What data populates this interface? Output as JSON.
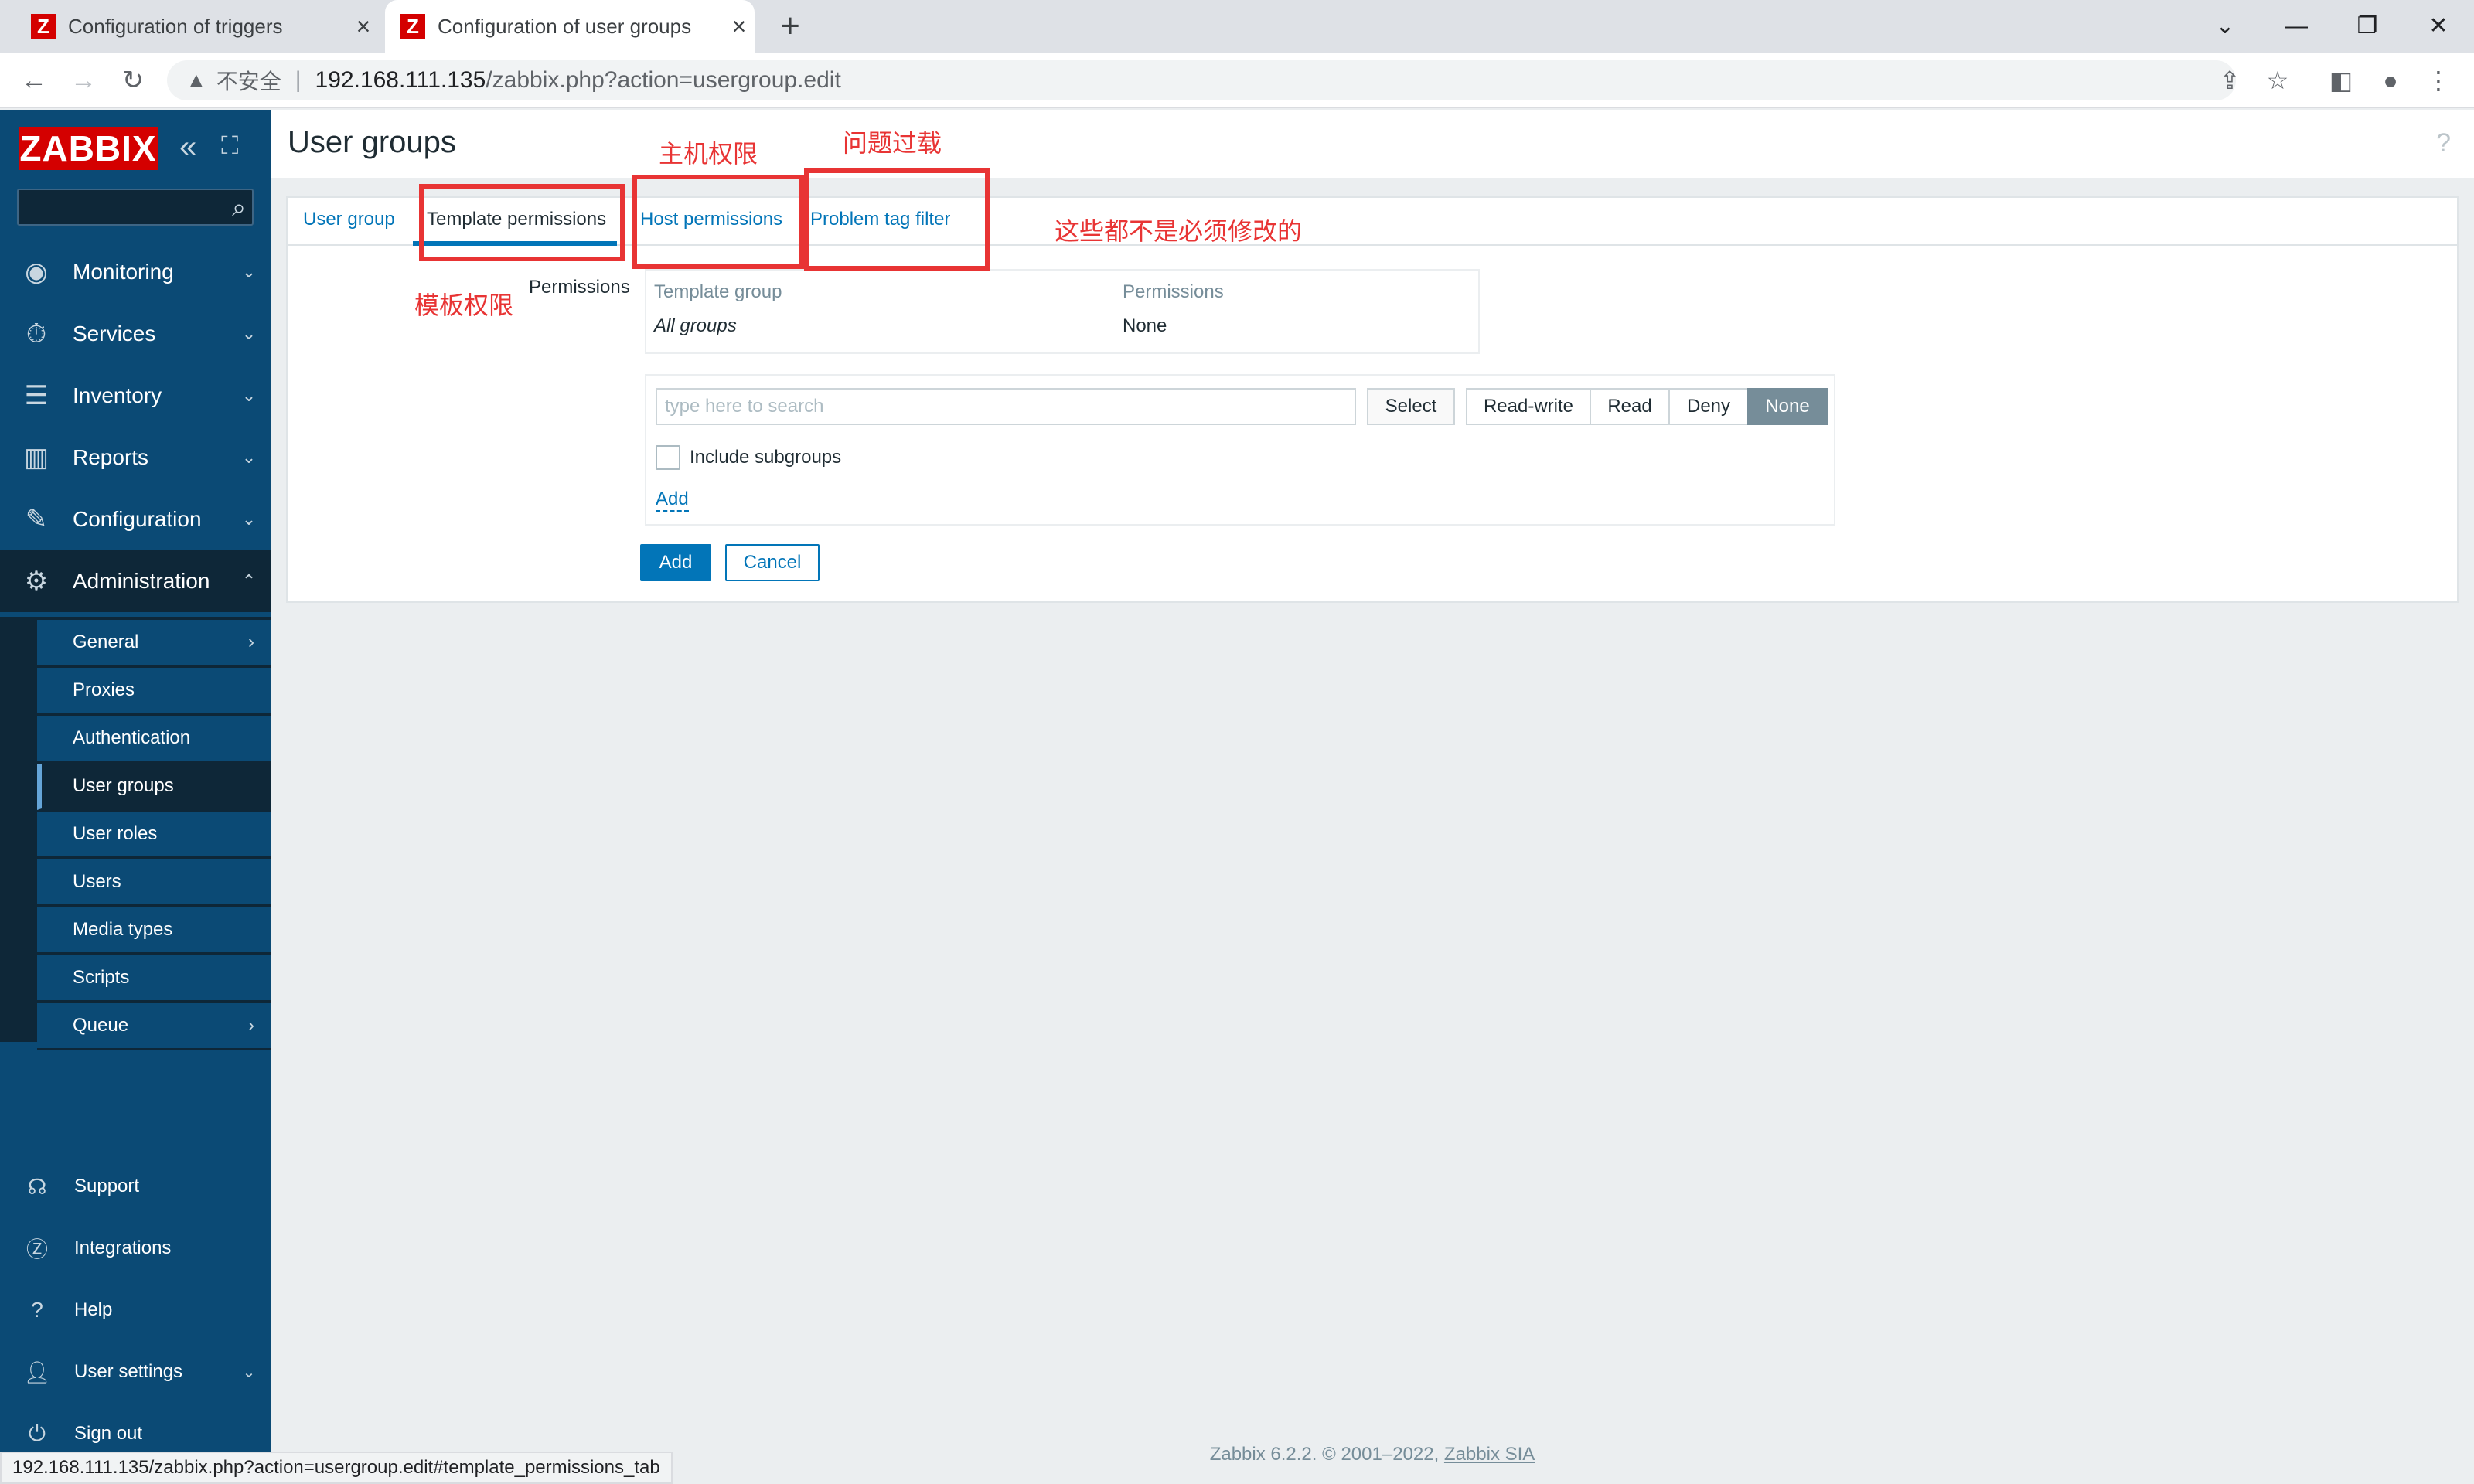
{
  "browser": {
    "tabs": [
      {
        "title": "Configuration of triggers",
        "favicon": "Z",
        "active": false
      },
      {
        "title": "Configuration of user groups",
        "favicon": "Z",
        "active": true
      }
    ],
    "new_tab": "+",
    "window_controls": {
      "minimize": "—",
      "restore": "❐",
      "close": "✕",
      "tab_list": "⌄"
    },
    "address": {
      "security_label": "不安全",
      "url_host": "192.168.111.135",
      "url_path": "/zabbix.php?action=usergroup.edit"
    },
    "status_url": "192.168.111.135/zabbix.php?action=usergroup.edit#template_permissions_tab"
  },
  "sidebar": {
    "logo": "ZABBIX",
    "search_placeholder": "",
    "menu": [
      {
        "label": "Monitoring",
        "icon": "eye-icon"
      },
      {
        "label": "Services",
        "icon": "stopwatch-icon"
      },
      {
        "label": "Inventory",
        "icon": "list-icon"
      },
      {
        "label": "Reports",
        "icon": "bar-chart-icon"
      },
      {
        "label": "Configuration",
        "icon": "wrench-icon"
      },
      {
        "label": "Administration",
        "icon": "gear-icon"
      }
    ],
    "submenu": [
      {
        "label": "General",
        "has_arrow": true
      },
      {
        "label": "Proxies"
      },
      {
        "label": "Authentication"
      },
      {
        "label": "User groups",
        "selected": true
      },
      {
        "label": "User roles"
      },
      {
        "label": "Users"
      },
      {
        "label": "Media types"
      },
      {
        "label": "Scripts"
      },
      {
        "label": "Queue",
        "has_arrow": true
      }
    ],
    "bottom": [
      {
        "label": "Support",
        "icon": "headset-icon"
      },
      {
        "label": "Integrations",
        "icon": "zabbix-icon"
      },
      {
        "label": "Help",
        "icon": "question-icon"
      },
      {
        "label": "User settings",
        "icon": "user-icon"
      },
      {
        "label": "Sign out",
        "icon": "power-icon"
      }
    ]
  },
  "page": {
    "title": "User groups",
    "help": "?",
    "tabs": [
      "User group",
      "Template permissions",
      "Host permissions",
      "Problem tag filter"
    ],
    "active_tab": "Template permissions",
    "permissions_label": "Permissions",
    "table": {
      "headers": [
        "Template group",
        "Permissions"
      ],
      "rows": [
        [
          "All groups",
          "None"
        ]
      ]
    },
    "form": {
      "search_placeholder": "type here to search",
      "select_label": "Select",
      "segments": [
        "Read-write",
        "Read",
        "Deny",
        "None"
      ],
      "selected_segment": "None",
      "include_subgroups": "Include subgroups",
      "include_subgroups_checked": false,
      "add_link": "Add"
    },
    "buttons": {
      "add": "Add",
      "cancel": "Cancel"
    }
  },
  "annotations": {
    "template_perm": "模板权限",
    "host_perm": "主机权限",
    "problem_tag": "问题过载",
    "not_required": "这些都不是必须修改的"
  },
  "footer": {
    "text": "Zabbix 6.2.2. © 2001–2022, ",
    "link": "Zabbix SIA"
  },
  "colors": {
    "sidebar": "#0b4a75",
    "accent": "#0275b8",
    "annotation": "#e83434",
    "logo": "#d40000"
  }
}
